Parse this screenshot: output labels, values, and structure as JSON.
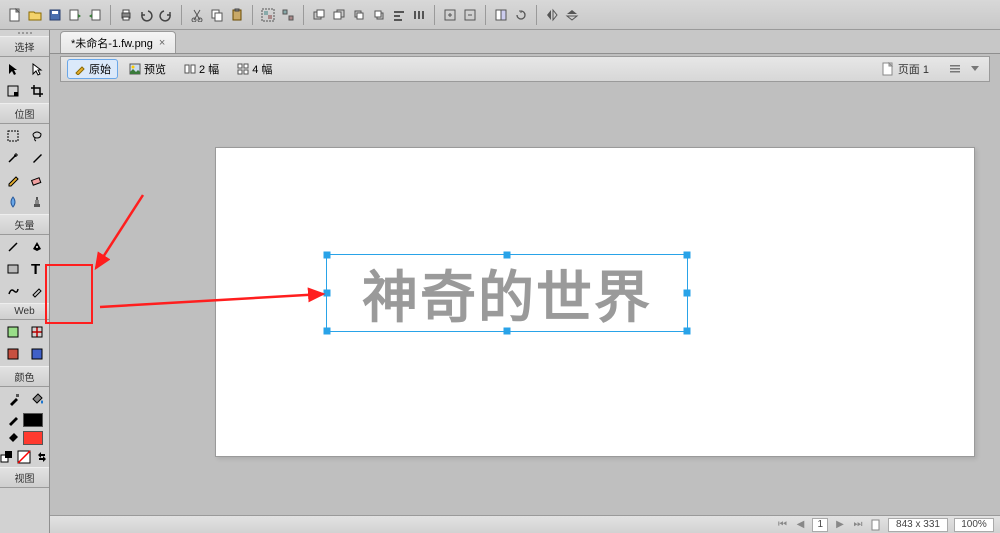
{
  "top_toolbar": {
    "icons": [
      "new-file-icon",
      "open-file-icon",
      "save-icon",
      "import-icon",
      "export-icon",
      "sep",
      "print-icon",
      "undo-icon",
      "redo-icon",
      "sep",
      "cut-icon",
      "copy-icon",
      "paste-icon",
      "sep",
      "group-icon",
      "ungroup-icon",
      "sep",
      "bring-front-icon",
      "send-back-icon",
      "bring-forward-icon",
      "send-backward-icon",
      "align-icon",
      "distribute-icon",
      "sep",
      "zoom-in-icon",
      "zoom-out-icon",
      "sep",
      "compare-icon",
      "rotate-ccw-icon",
      "sep",
      "flip-h-icon",
      "flip-v-icon"
    ]
  },
  "tool_panel": {
    "sections": {
      "select": "选择",
      "bitmap": "位图",
      "vector": "矢量",
      "web": "Web",
      "colors": "颜色",
      "view": "视图"
    },
    "tools": {
      "select": [
        "pointer-tool-icon",
        "subselect-tool-icon",
        "scale-tool-icon",
        "crop-tool-icon"
      ],
      "bitmap": [
        "marquee-tool-icon",
        "lasso-tool-icon",
        "magic-wand-tool-icon",
        "brush-tool-icon",
        "pencil-tool-icon",
        "eraser-tool-icon",
        "blur-tool-icon",
        "rubber-stamp-tool-icon"
      ],
      "vector": [
        "line-tool-icon",
        "pen-tool-icon",
        "rectangle-tool-icon",
        "text-tool-icon",
        "freeform-tool-icon",
        "knife-tool-icon"
      ],
      "web": [
        "hotspot-tool-icon",
        "slice-tool-icon",
        "hide-slice-icon",
        "show-slice-icon"
      ],
      "colors": [
        "eyedropper-tool-icon",
        "paint-bucket-tool-icon"
      ]
    },
    "color_swatches": {
      "stroke": "#000000",
      "fill": "#ff3a2f",
      "default": "#ffffff"
    }
  },
  "document_tab": {
    "title": "*未命名-1.fw.png",
    "close": "×"
  },
  "view_modes": {
    "original": "原始",
    "preview": "预览",
    "two_up": "2 幅",
    "four_up": "4 幅"
  },
  "page_indicator": {
    "icon": "page-icon",
    "label": "页面 1"
  },
  "canvas": {
    "text_content": "神奇的世界"
  },
  "status": {
    "page_current": "1",
    "dimensions": "843 x 331",
    "zoom": "100%"
  },
  "annotations": {
    "highlighted_tool": "text-tool-icon"
  }
}
